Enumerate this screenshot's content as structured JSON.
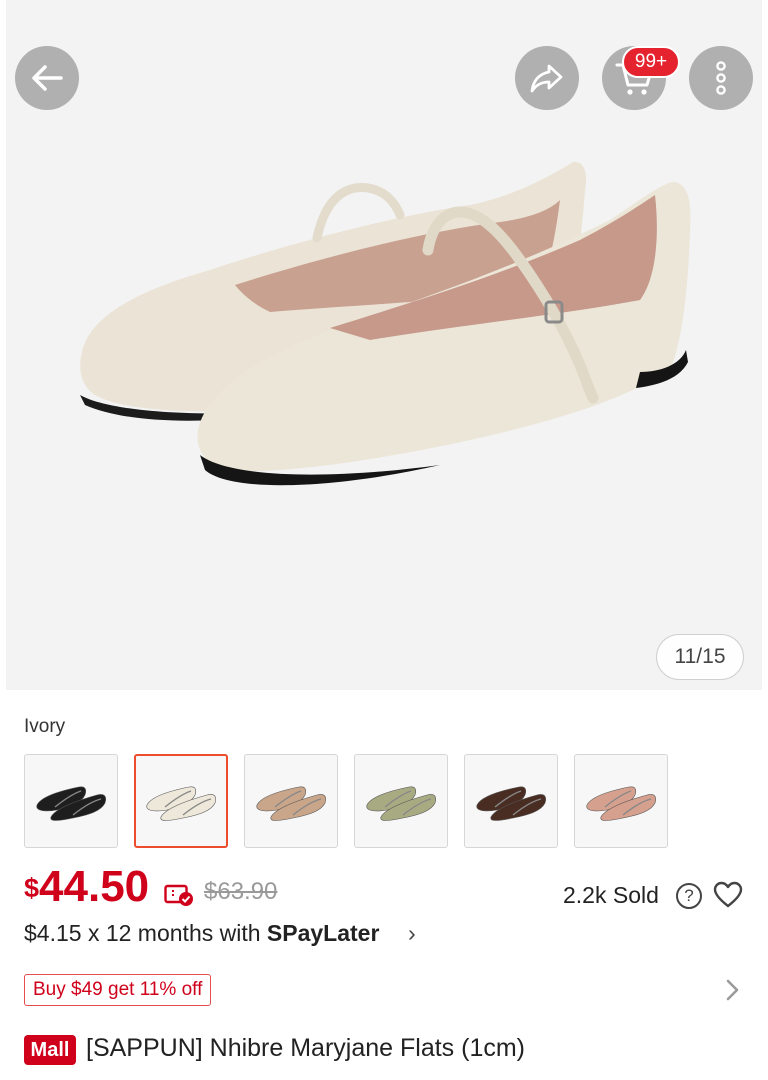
{
  "header": {
    "cart_badge": "99+",
    "image_counter": "11/15",
    "icons": [
      "back-arrow-icon",
      "share-icon",
      "cart-icon",
      "more-vertical-icon"
    ]
  },
  "product": {
    "variant_label": "Ivory",
    "variants": [
      {
        "name": "Black",
        "color": "#1e1e1e",
        "selected": false
      },
      {
        "name": "Ivory",
        "color": "#eee8da",
        "selected": true
      },
      {
        "name": "Beige",
        "color": "#c9a58a",
        "selected": false
      },
      {
        "name": "Sage",
        "color": "#a8ab82",
        "selected": false
      },
      {
        "name": "Brown",
        "color": "#4a2d22",
        "selected": false
      },
      {
        "name": "Pink",
        "color": "#d6a08e",
        "selected": false
      }
    ],
    "price_currency": "$",
    "price_amount": "44.50",
    "original_price": "$63.90",
    "sold": "2.2k Sold",
    "help": "?",
    "installment_prefix": "$4.15 x 12 months with ",
    "installment_brand": "SPayLater",
    "installment_chevron": "›",
    "promo": "Buy $49 get 11% off",
    "mall_badge": "Mall",
    "title": "[SAPPUN] Nhibre Maryjane Flats (1cm)"
  },
  "colors": {
    "accent": "#d0011b",
    "selected_border": "#ee4d2d",
    "badge": "#e5232e",
    "hero_bg": "#f3f3f3",
    "shoe_ivory": "#ece6d8"
  }
}
